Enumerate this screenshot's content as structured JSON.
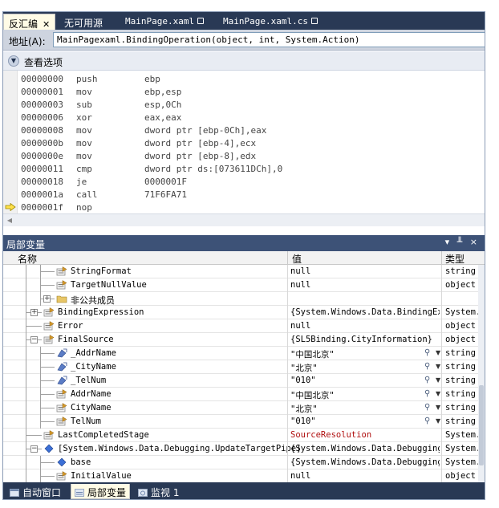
{
  "tabs": [
    {
      "label": "反汇编",
      "active": true
    },
    {
      "label": "无可用源",
      "active": false
    },
    {
      "label": "MainPage.xaml",
      "active": false,
      "locked": true
    },
    {
      "label": "MainPage.xaml.cs",
      "active": false,
      "locked": true
    }
  ],
  "address": {
    "label": "地址(A):",
    "value": "MainPagexaml.BindingOperation(object, int, System.Action)"
  },
  "view_options": {
    "label": "查看选项"
  },
  "disassembly": [
    {
      "addr": "00000000",
      "op": "push",
      "arg": "ebp"
    },
    {
      "addr": "00000001",
      "op": "mov",
      "arg": "ebp,esp"
    },
    {
      "addr": "00000003",
      "op": "sub",
      "arg": "esp,0Ch"
    },
    {
      "addr": "00000006",
      "op": "xor",
      "arg": "eax,eax"
    },
    {
      "addr": "00000008",
      "op": "mov",
      "arg": "dword ptr [ebp-0Ch],eax"
    },
    {
      "addr": "0000000b",
      "op": "mov",
      "arg": "dword ptr [ebp-4],ecx"
    },
    {
      "addr": "0000000e",
      "op": "mov",
      "arg": "dword ptr [ebp-8],edx"
    },
    {
      "addr": "00000011",
      "op": "cmp",
      "arg": "dword ptr ds:[073611DCh],0"
    },
    {
      "addr": "00000018",
      "op": "je",
      "arg": "0000001F"
    },
    {
      "addr": "0000001a",
      "op": "call",
      "arg": "71F6FA71"
    },
    {
      "addr": "0000001f",
      "op": "nop",
      "arg": ""
    }
  ],
  "locals": {
    "title": "局部变量",
    "title_controls": "▾ ╨ ×",
    "columns": {
      "name": "名称",
      "value": "值",
      "type": "类型"
    },
    "rows": [
      {
        "name": "StringFormat",
        "value": "null",
        "type": "string"
      },
      {
        "name": "TargetNullValue",
        "value": "null",
        "type": "object"
      },
      {
        "name": "非公共成员",
        "value": "",
        "type": ""
      },
      {
        "name": "BindingExpression",
        "value": "{System.Windows.Data.BindingExp",
        "type": "System.W"
      },
      {
        "name": "Error",
        "value": "null",
        "type": "object"
      },
      {
        "name": "FinalSource",
        "value": "{SL5Binding.CityInformation}",
        "type": "object"
      },
      {
        "name": "_AddrName",
        "value": "\"中国北京\"",
        "type": "string"
      },
      {
        "name": "_CityName",
        "value": "\"北京\"",
        "type": "string"
      },
      {
        "name": "_TelNum",
        "value": "\"010\"",
        "type": "string"
      },
      {
        "name": "AddrName",
        "value": "\"中国北京\"",
        "type": "string"
      },
      {
        "name": "CityName",
        "value": "\"北京\"",
        "type": "string"
      },
      {
        "name": "TelNum",
        "value": "\"010\"",
        "type": "string"
      },
      {
        "name": "LastCompletedStage",
        "value": "SourceResolution",
        "type": "System.W"
      },
      {
        "name": "[System.Windows.Data.Debugging.UpdateTargetPipe]",
        "value": "{System.Windows.Data.Debugging.",
        "type": "System.W"
      },
      {
        "name": "base",
        "value": "{System.Windows.Data.Debugging.",
        "type": "System.W"
      },
      {
        "name": "InitialValue",
        "value": "null",
        "type": "object"
      }
    ]
  },
  "bottom_tabs": [
    {
      "label": "自动窗口",
      "active": false
    },
    {
      "label": "局部变量",
      "active": true
    },
    {
      "label": "监视 1",
      "active": false
    }
  ],
  "colors": {
    "titlebar": "#293955",
    "panel_title": "#3d5277",
    "value_red": "#b01010"
  }
}
